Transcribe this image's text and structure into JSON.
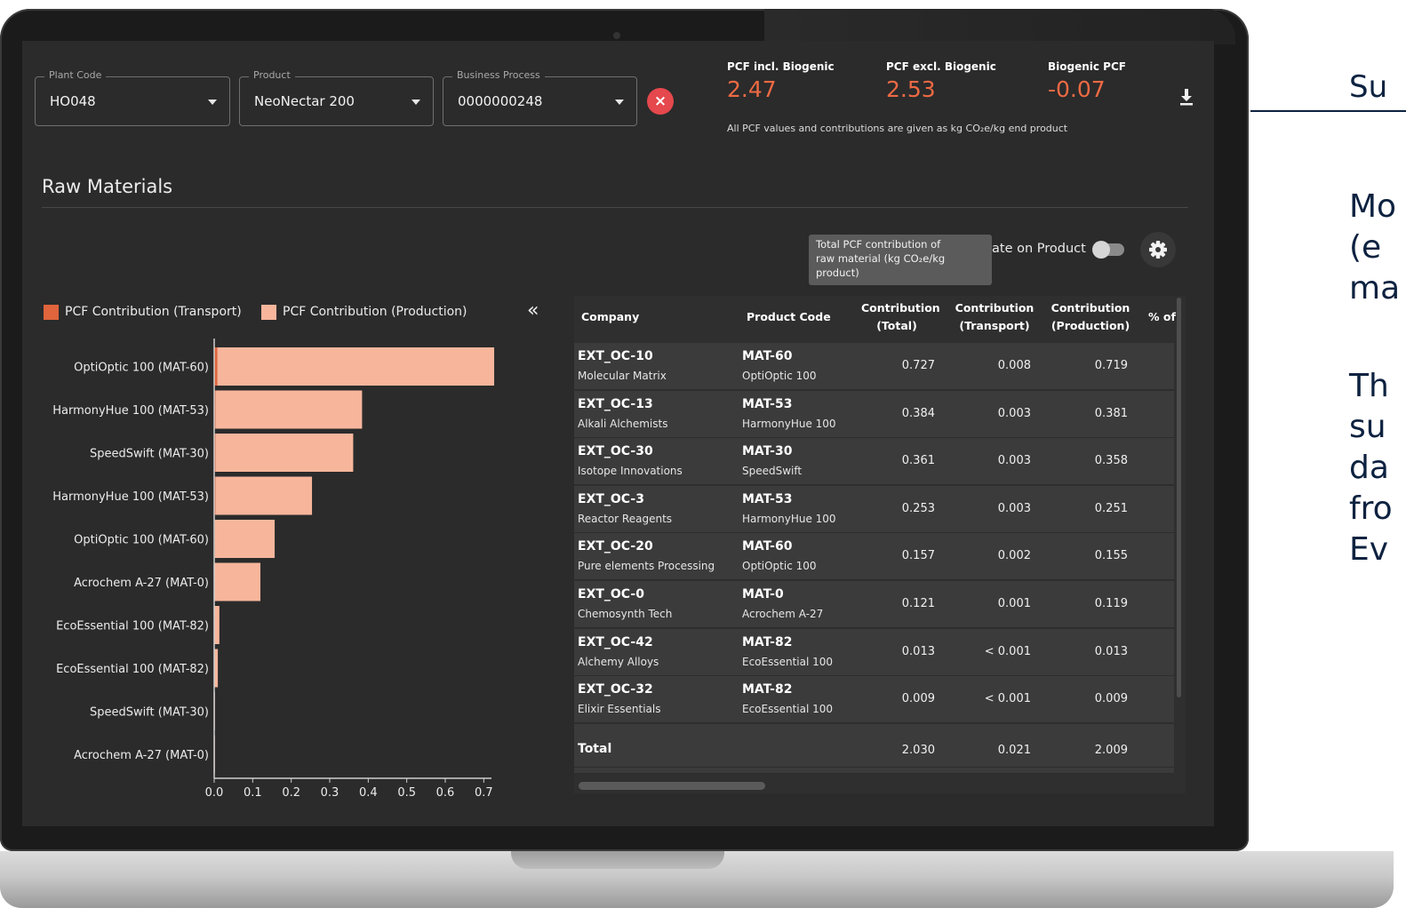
{
  "slide": {
    "title_fragment": "Su",
    "para1": [
      "Mo",
      "(e",
      "ma"
    ],
    "para2": [
      "Th",
      "su",
      "da",
      "fro",
      "Ev"
    ]
  },
  "filters": {
    "plant": {
      "label": "Plant Code",
      "value": "HO048"
    },
    "product": {
      "label": "Product",
      "value": "NeoNectar 200"
    },
    "process": {
      "label": "Business Process",
      "value": "0000000248"
    },
    "clear_icon": "close-icon"
  },
  "kpis": [
    {
      "label": "PCF incl. Biogenic",
      "value": "2.47"
    },
    {
      "label": "PCF excl. Biogenic",
      "value": "2.53"
    },
    {
      "label": "Biogenic PCF",
      "value": "-0.07"
    }
  ],
  "kpi_note": "All PCF values and contributions are given as kg CO₂e/kg end product",
  "section_title": "Raw Materials",
  "tooltip": [
    "Total PCF contribution of",
    "raw material (kg CO₂e/kg",
    "product)"
  ],
  "toggle_label": "ate on Product",
  "legend": {
    "transport": "PCF Contribution (Transport)",
    "production": "PCF Contribution (Production)",
    "collapse": "«"
  },
  "colors": {
    "transport": "#e0643c",
    "production": "#f7b69c",
    "accent": "#ee6a44",
    "clear": "#e5484d"
  },
  "chart_data": {
    "type": "bar",
    "orientation": "horizontal",
    "stacked": true,
    "categories": [
      "OptiOptic 100 (MAT-60)",
      "HarmonyHue 100 (MAT-53)",
      "SpeedSwift (MAT-30)",
      "HarmonyHue 100 (MAT-53)",
      "OptiOptic 100 (MAT-60)",
      "Acrochem A-27 (MAT-0)",
      "EcoEssential 100 (MAT-82)",
      "EcoEssential 100 (MAT-82)",
      "SpeedSwift (MAT-30)",
      "Acrochem A-27 (MAT-0)"
    ],
    "series": [
      {
        "name": "PCF Contribution (Transport)",
        "values": [
          0.008,
          0.003,
          0.003,
          0.003,
          0.002,
          0.001,
          0.0005,
          0.0005,
          0.0,
          0.0
        ]
      },
      {
        "name": "PCF Contribution (Production)",
        "values": [
          0.719,
          0.381,
          0.358,
          0.251,
          0.155,
          0.119,
          0.013,
          0.009,
          0.001,
          0.0005
        ]
      }
    ],
    "xlim": [
      0,
      0.72
    ],
    "xticks": [
      "0.0",
      "0.1",
      "0.2",
      "0.3",
      "0.4",
      "0.5",
      "0.6",
      "0.7"
    ],
    "grid": false
  },
  "table": {
    "headers": {
      "company": "Company",
      "product_code": "Product Code",
      "total": [
        "Contribution",
        "(Total)"
      ],
      "transport": [
        "Contribution",
        "(Transport)"
      ],
      "production": [
        "Contribution",
        "(Production)"
      ],
      "percent": "% of"
    },
    "rows": [
      {
        "company": "EXT_OC-10",
        "company_name": "Molecular Matrix",
        "code": "MAT-60",
        "product": "OptiOptic 100",
        "total": "0.727",
        "transport": "0.008",
        "production": "0.719"
      },
      {
        "company": "EXT_OC-13",
        "company_name": "Alkali Alchemists",
        "code": "MAT-53",
        "product": "HarmonyHue 100",
        "total": "0.384",
        "transport": "0.003",
        "production": "0.381"
      },
      {
        "company": "EXT_OC-30",
        "company_name": "Isotope Innovations",
        "code": "MAT-30",
        "product": "SpeedSwift",
        "total": "0.361",
        "transport": "0.003",
        "production": "0.358"
      },
      {
        "company": "EXT_OC-3",
        "company_name": "Reactor Reagents",
        "code": "MAT-53",
        "product": "HarmonyHue 100",
        "total": "0.253",
        "transport": "0.003",
        "production": "0.251"
      },
      {
        "company": "EXT_OC-20",
        "company_name": "Pure elements Processing",
        "code": "MAT-60",
        "product": "OptiOptic 100",
        "total": "0.157",
        "transport": "0.002",
        "production": "0.155"
      },
      {
        "company": "EXT_OC-0",
        "company_name": "Chemosynth Tech",
        "code": "MAT-0",
        "product": "Acrochem A-27",
        "total": "0.121",
        "transport": "0.001",
        "production": "0.119"
      },
      {
        "company": "EXT_OC-42",
        "company_name": "Alchemy Alloys",
        "code": "MAT-82",
        "product": "EcoEssential 100",
        "total": "0.013",
        "transport": "< 0.001",
        "production": "0.013"
      },
      {
        "company": "EXT_OC-32",
        "company_name": "Elixir Essentials",
        "code": "MAT-82",
        "product": "EcoEssential 100",
        "total": "0.009",
        "transport": "< 0.001",
        "production": "0.009"
      }
    ],
    "total_row": {
      "label": "Total",
      "total": "2.030",
      "transport": "0.021",
      "production": "2.009"
    }
  }
}
